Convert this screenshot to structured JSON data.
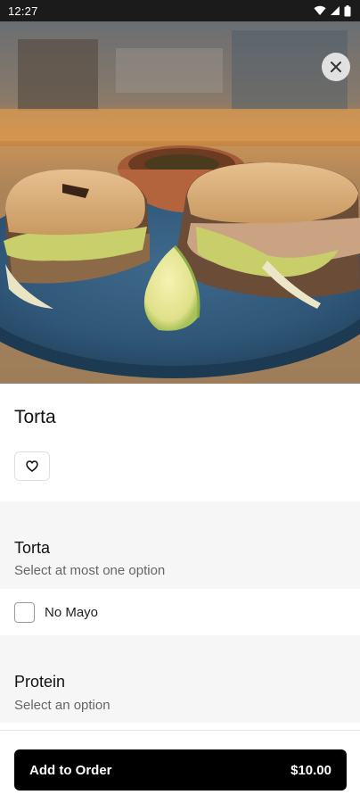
{
  "status_bar": {
    "time": "12:27"
  },
  "item": {
    "title": "Torta",
    "image_icon": "torta-photo"
  },
  "groups": [
    {
      "title": "Torta",
      "subtitle": "Select at most one option",
      "options": [
        {
          "label": "No Mayo",
          "checked": false
        }
      ]
    },
    {
      "title": "Protein",
      "subtitle": "Select an option"
    }
  ],
  "bottom": {
    "button_label": "Add to Order",
    "price": "$10.00"
  },
  "colors": {
    "button_bg": "#000000",
    "section_bg": "#f6f6f6",
    "status_bg": "#1b1b1b"
  }
}
